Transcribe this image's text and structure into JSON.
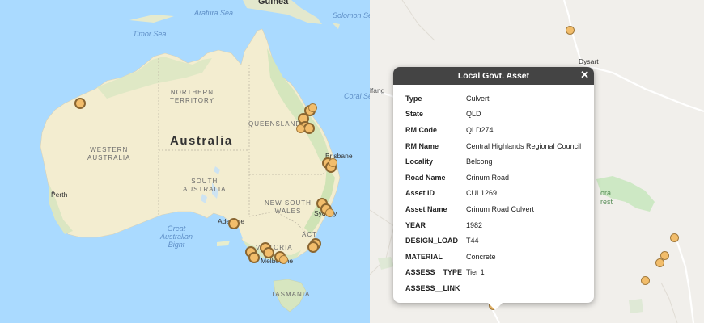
{
  "left_map": {
    "country_label": "Australia",
    "sea_labels": [
      {
        "text": "Arafura Sea"
      },
      {
        "text": "Timor Sea"
      },
      {
        "text": "Solomon Se"
      },
      {
        "text": "Coral Se"
      },
      {
        "text": "Great\nAustralian\nBight"
      },
      {
        "text": "Guinea"
      }
    ],
    "state_labels": [
      {
        "text": "NORTHERN\nTERRITORY"
      },
      {
        "text": "QUEENSLAND"
      },
      {
        "text": "WESTERN\nAUSTRALIA"
      },
      {
        "text": "SOUTH\nAUSTRALIA"
      },
      {
        "text": "NEW SOUTH\nWALES"
      },
      {
        "text": "VICTORIA"
      },
      {
        "text": "ACT"
      },
      {
        "text": "TASMANIA"
      }
    ],
    "city_labels": [
      {
        "text": "Perth"
      },
      {
        "text": "Brisbane"
      },
      {
        "text": "Sydney"
      },
      {
        "text": "Adelaide"
      },
      {
        "text": "Melbourne"
      }
    ]
  },
  "right_map": {
    "place_labels": [
      {
        "text": "Dysart"
      },
      {
        "text": "lfang"
      },
      {
        "text": "ora\nrest"
      }
    ]
  },
  "popup": {
    "title": "Local Govt. Asset",
    "close_glyph": "✕",
    "rows": [
      {
        "key": "Type",
        "value": "Culvert"
      },
      {
        "key": "State",
        "value": "QLD"
      },
      {
        "key": "RM Code",
        "value": "QLD274"
      },
      {
        "key": "RM Name",
        "value": "Central Highlands Regional Council"
      },
      {
        "key": "Locality",
        "value": "Belcong"
      },
      {
        "key": "Road Name",
        "value": "Crinum Road"
      },
      {
        "key": "Asset ID",
        "value": "CUL1269"
      },
      {
        "key": "Asset Name",
        "value": "Crinum Road Culvert"
      },
      {
        "key": "YEAR",
        "value": "1982"
      },
      {
        "key": "DESIGN_LOAD",
        "value": "T44"
      },
      {
        "key": "MATERIAL",
        "value": "Concrete"
      },
      {
        "key": "ASSESS__TYPE",
        "value": "Tier 1"
      },
      {
        "key": "ASSESS__LINK",
        "value": ""
      }
    ]
  },
  "colors": {
    "ocean": "#aadaff",
    "land": "#f3edd0",
    "marker_fill": "#f2bd6b",
    "popup_header": "#444444"
  }
}
